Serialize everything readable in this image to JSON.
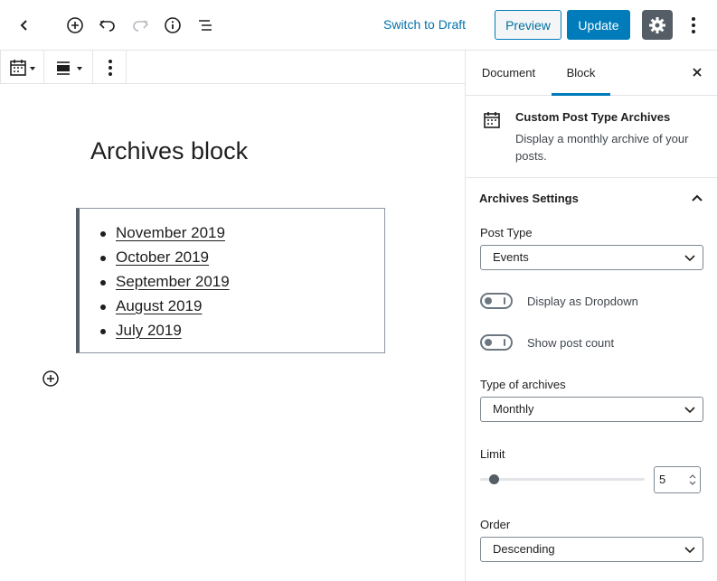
{
  "toolbar": {
    "switch_to_draft": "Switch to Draft",
    "preview": "Preview",
    "update": "Update"
  },
  "editor": {
    "block_title": "Archives block",
    "archives": [
      "November 2019",
      "October 2019",
      "September 2019",
      "August 2019",
      "July 2019"
    ]
  },
  "sidebar": {
    "tabs": [
      "Document",
      "Block"
    ],
    "active_tab": "Block",
    "block_card": {
      "title": "Custom Post Type Archives",
      "description": "Display a monthly archive of your posts."
    },
    "panel_title": "Archives Settings",
    "post_type": {
      "label": "Post Type",
      "value": "Events"
    },
    "display_as_dropdown": {
      "label": "Display as Dropdown",
      "checked": false
    },
    "show_post_count": {
      "label": "Show post count",
      "checked": false
    },
    "type_of_archives": {
      "label": "Type of archives",
      "value": "Monthly"
    },
    "limit": {
      "label": "Limit",
      "value": "5"
    },
    "order": {
      "label": "Order",
      "value": "Descending"
    }
  },
  "colors": {
    "accent": "#007cba",
    "link": "#0073aa",
    "settings_button": "#555d66"
  }
}
